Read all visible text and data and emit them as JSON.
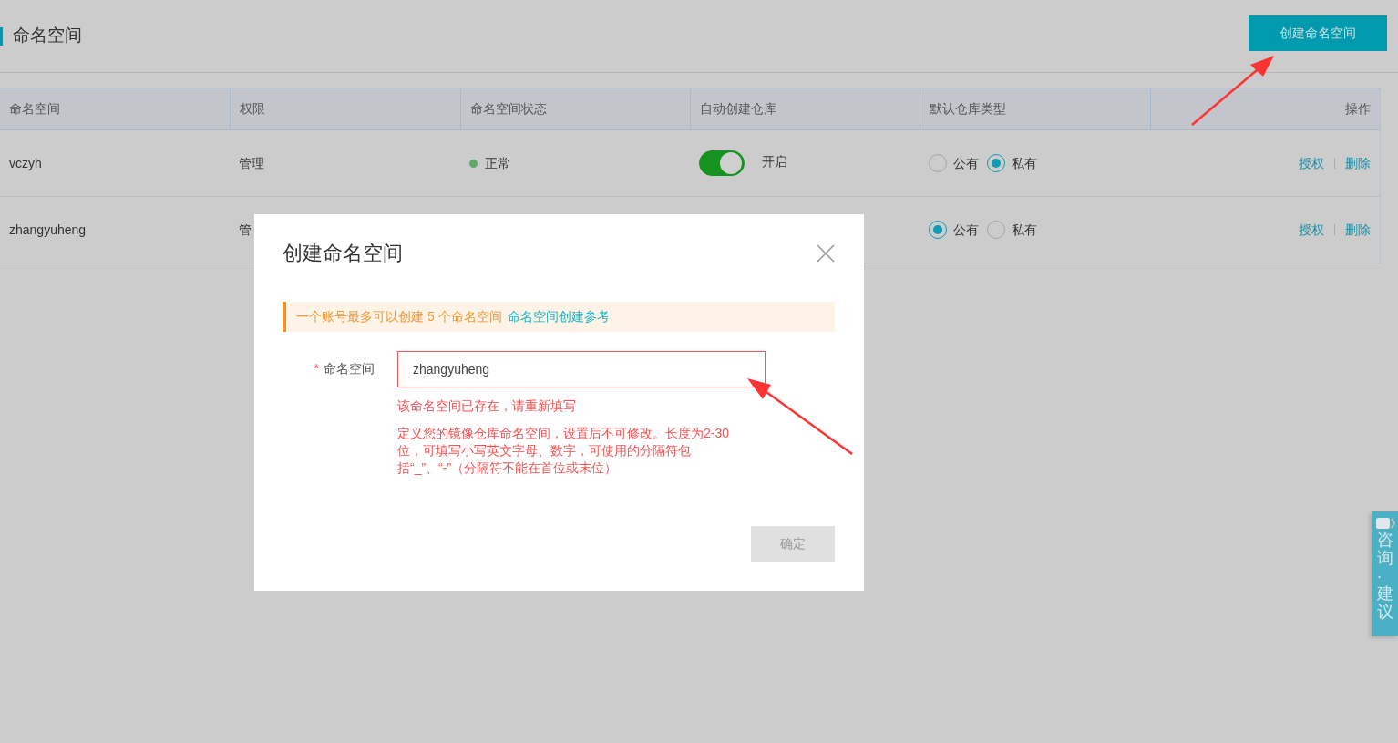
{
  "page_title": "命名空间",
  "create_button": "创建命名空间",
  "table": {
    "columns": [
      "命名空间",
      "权限",
      "命名空间状态",
      "自动创建仓库",
      "默认仓库类型",
      "操作"
    ],
    "rows": [
      {
        "namespace": "vczyh",
        "permission": "管理",
        "status": {
          "label": "正常",
          "color": "#5fa86a"
        },
        "auto_create": {
          "on": true,
          "label": "开启"
        },
        "repo_type": [
          {
            "label": "公有",
            "selected": false
          },
          {
            "label": "私有",
            "selected": true
          }
        ],
        "actions": [
          "授权",
          "删除"
        ]
      },
      {
        "namespace": "zhangyuheng",
        "permission": "管",
        "repo_type": [
          {
            "label": "公有",
            "selected": true
          },
          {
            "label": "私有",
            "selected": false
          }
        ],
        "actions": [
          "授权",
          "删除"
        ]
      }
    ]
  },
  "dialog": {
    "title": "创建命名空间",
    "notice": {
      "text": "一个账号最多可以创建 5 个命名空间",
      "link": "命名空间创建参考"
    },
    "field": {
      "label": "命名空间",
      "required_mark": "*",
      "value": "zhangyuheng",
      "invalid": true,
      "error": "该命名空间已存在，请重新填写",
      "help": "定义您的镜像仓库命名空间，设置后不可修改。长度为2-30位，可填写小写英文字母、数字，可使用的分隔符包括“_”、“-”（分隔符不能在首位或末位）"
    },
    "confirm": {
      "label": "确定",
      "disabled": true
    }
  },
  "side_tab": {
    "label": "咨询·建议"
  }
}
